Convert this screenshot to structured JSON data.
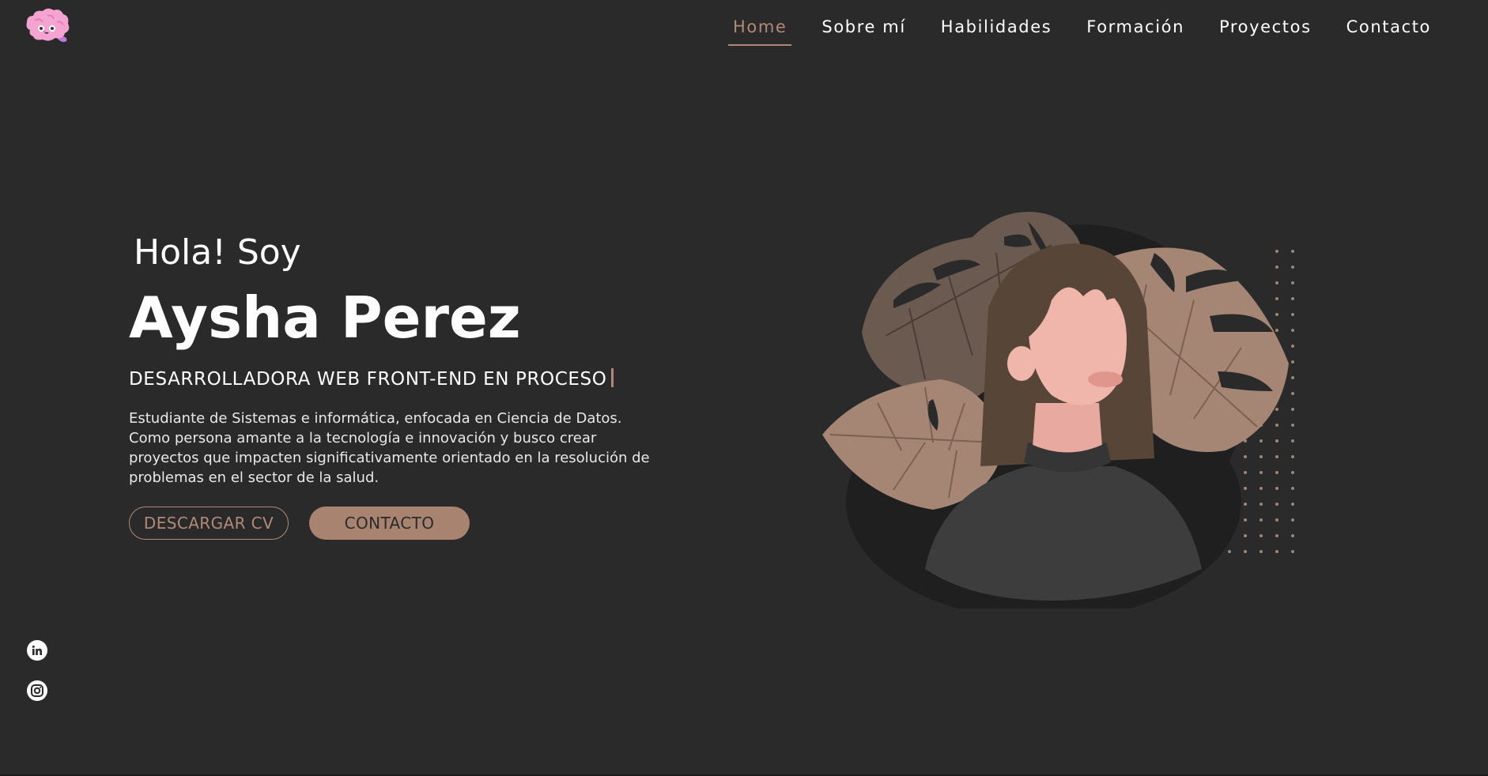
{
  "nav": {
    "items": [
      {
        "label": "Home",
        "active": true
      },
      {
        "label": "Sobre mí",
        "active": false
      },
      {
        "label": "Habilidades",
        "active": false
      },
      {
        "label": "Formación",
        "active": false
      },
      {
        "label": "Proyectos",
        "active": false
      },
      {
        "label": "Contacto",
        "active": false
      }
    ]
  },
  "hero": {
    "greeting": "Hola! Soy",
    "name": "Aysha Perez",
    "role": "DESARROLLADORA WEB FRONT-END EN PROCESO",
    "description": "Estudiante de Sistemas e informática, enfocada en Ciencia de Datos. Como persona amante a la tecnología e innovación y busco crear proyectos que impacten significativamente orientado en la resolución de problemas en el sector de la salud.",
    "buttons": {
      "cv_label": "DESCARGAR CV",
      "contact_label": "CONTACTO"
    }
  },
  "icons": {
    "logo": "brain-icon",
    "social": [
      "linkedin-icon",
      "instagram-icon"
    ]
  },
  "colors": {
    "background": "#2a2a2a",
    "accent": "#b08a76",
    "text": "#ffffff"
  }
}
